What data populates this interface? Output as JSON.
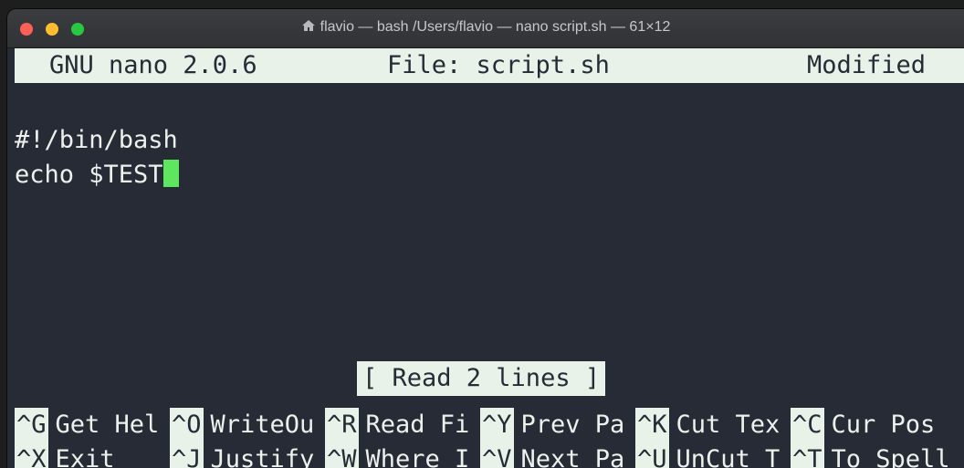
{
  "window": {
    "title": "flavio — bash /Users/flavio — nano script.sh — 61×12",
    "icon": "home-icon"
  },
  "nano": {
    "version": "GNU nano 2.0.6",
    "file": "File: script.sh",
    "state": "Modified",
    "lines": [
      "#!/bin/bash",
      "echo $TEST"
    ],
    "status_message": "[ Read 2 lines ]",
    "shortcuts_row1": [
      {
        "key": "^G",
        "label": "Get Hel"
      },
      {
        "key": "^O",
        "label": "WriteOu"
      },
      {
        "key": "^R",
        "label": "Read Fi"
      },
      {
        "key": "^Y",
        "label": "Prev Pa"
      },
      {
        "key": "^K",
        "label": "Cut Tex"
      },
      {
        "key": "^C",
        "label": "Cur Pos"
      }
    ],
    "shortcuts_row2": [
      {
        "key": "^X",
        "label": "Exit"
      },
      {
        "key": "^J",
        "label": "Justify"
      },
      {
        "key": "^W",
        "label": "Where I"
      },
      {
        "key": "^V",
        "label": "Next Pa"
      },
      {
        "key": "^U",
        "label": "UnCut T"
      },
      {
        "key": "^T",
        "label": "To Spell"
      }
    ]
  },
  "colors": {
    "background": "#272b36",
    "foreground": "#ecf1ec",
    "cursor": "#5ee65e",
    "inverse_bg": "#e8f2e8"
  }
}
